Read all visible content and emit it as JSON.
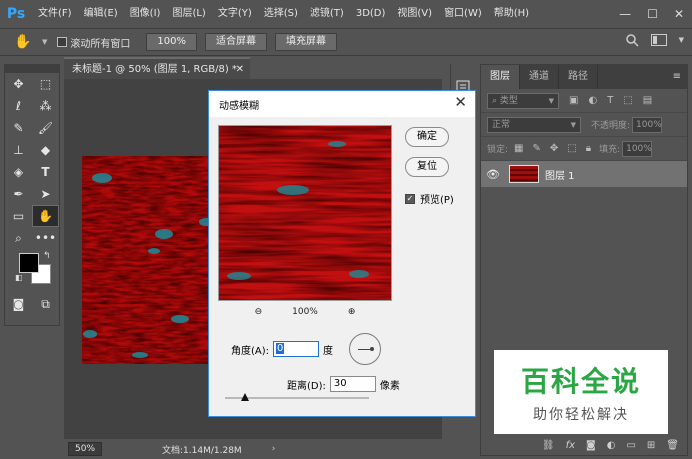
{
  "app": {
    "logo": "Ps"
  },
  "menu": [
    "文件(F)",
    "编辑(E)",
    "图像(I)",
    "图层(L)",
    "文字(Y)",
    "选择(S)",
    "滤镜(T)",
    "3D(D)",
    "视图(V)",
    "窗口(W)",
    "帮助(H)"
  ],
  "window_controls": {
    "minimize": "—",
    "maximize": "☐",
    "close": "✕"
  },
  "options_bar": {
    "scroll_all_label": "滚动所有窗口",
    "scroll_all_checked": false,
    "zoom_100": "100%",
    "fit_screen": "适合屏幕",
    "fill_screen": "填充屏幕"
  },
  "document": {
    "tab_title": "未标题-1 @ 50% (图层 1, RGB/8) *",
    "status_zoom": "50%",
    "status_doc": "文档:1.14M/1.28M"
  },
  "layers_panel": {
    "tabs": [
      "图层",
      "通道",
      "路径"
    ],
    "active_tab": 0,
    "filter_kind": "类型",
    "blend_mode": "正常",
    "opacity_label": "不透明度:",
    "opacity_value": "100%",
    "lock_label": "锁定:",
    "fill_label": "填充:",
    "fill_value": "100%",
    "layers": [
      {
        "name": "图层 1",
        "visible": true
      }
    ]
  },
  "dialog": {
    "title": "动感模糊",
    "ok": "确定",
    "reset": "复位",
    "preview_label": "预览(P)",
    "preview_checked": true,
    "zoom": "100%",
    "angle_label": "角度(A):",
    "angle_value": "0",
    "angle_unit": "度",
    "distance_label": "距离(D):",
    "distance_value": "30",
    "distance_unit": "像素"
  },
  "watermark": {
    "title": "百科全说",
    "subtitle": "助你轻松解决"
  },
  "colors": {
    "accent": "#31a8ff",
    "dialog_border": "#3e8ddb",
    "watermark_green": "#2aa644",
    "panel": "#535353"
  }
}
